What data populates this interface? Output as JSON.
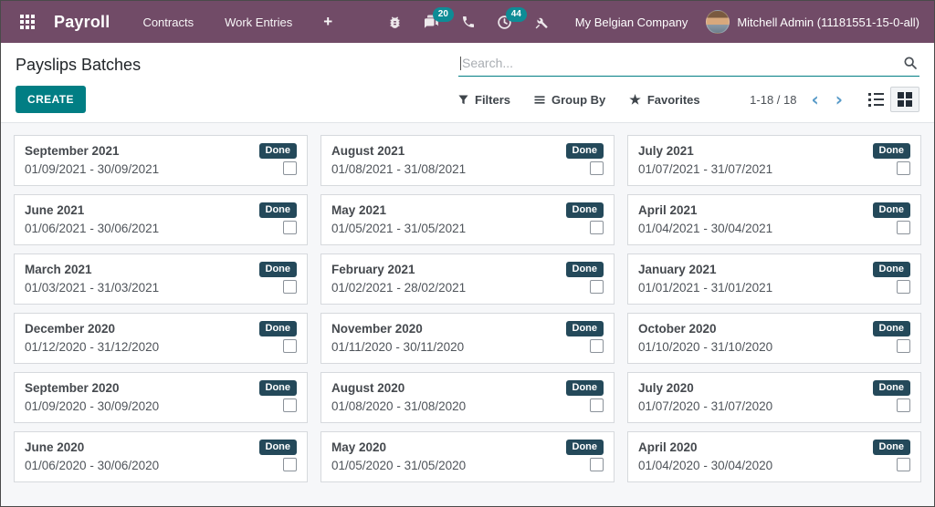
{
  "topbar": {
    "app_name": "Payroll",
    "menus": [
      {
        "label": "Contracts"
      },
      {
        "label": "Work Entries"
      },
      {
        "label": "+"
      }
    ],
    "badges": {
      "messages": "20",
      "activities": "44"
    },
    "company": "My Belgian Company",
    "user": "Mitchell Admin (11181551-15-0-all)"
  },
  "control_panel": {
    "title": "Payslips Batches",
    "create_label": "CREATE",
    "search_placeholder": "Search...",
    "filters_label": "Filters",
    "group_by_label": "Group By",
    "favorites_label": "Favorites",
    "pager_text": "1-18 / 18",
    "prev_glyph": "‹",
    "next_glyph": "›",
    "star_glyph": "★"
  },
  "colors": {
    "navbar-bg": "#714B67",
    "primary": "#017e84",
    "badge-done-bg": "#24495a",
    "icon-badge-bg": "#0e8c96",
    "pager-arrow": "#579ac8"
  },
  "cards": [
    {
      "title": "September 2021",
      "range": "01/09/2021 - 30/09/2021",
      "status": "Done"
    },
    {
      "title": "August 2021",
      "range": "01/08/2021 - 31/08/2021",
      "status": "Done"
    },
    {
      "title": "July 2021",
      "range": "01/07/2021 - 31/07/2021",
      "status": "Done"
    },
    {
      "title": "June 2021",
      "range": "01/06/2021 - 30/06/2021",
      "status": "Done"
    },
    {
      "title": "May 2021",
      "range": "01/05/2021 - 31/05/2021",
      "status": "Done"
    },
    {
      "title": "April 2021",
      "range": "01/04/2021 - 30/04/2021",
      "status": "Done"
    },
    {
      "title": "March 2021",
      "range": "01/03/2021 - 31/03/2021",
      "status": "Done"
    },
    {
      "title": "February 2021",
      "range": "01/02/2021 - 28/02/2021",
      "status": "Done"
    },
    {
      "title": "January 2021",
      "range": "01/01/2021 - 31/01/2021",
      "status": "Done"
    },
    {
      "title": "December 2020",
      "range": "01/12/2020 - 31/12/2020",
      "status": "Done"
    },
    {
      "title": "November 2020",
      "range": "01/11/2020 - 30/11/2020",
      "status": "Done"
    },
    {
      "title": "October 2020",
      "range": "01/10/2020 - 31/10/2020",
      "status": "Done"
    },
    {
      "title": "September 2020",
      "range": "01/09/2020 - 30/09/2020",
      "status": "Done"
    },
    {
      "title": "August 2020",
      "range": "01/08/2020 - 31/08/2020",
      "status": "Done"
    },
    {
      "title": "July 2020",
      "range": "01/07/2020 - 31/07/2020",
      "status": "Done"
    },
    {
      "title": "June 2020",
      "range": "01/06/2020 - 30/06/2020",
      "status": "Done"
    },
    {
      "title": "May 2020",
      "range": "01/05/2020 - 31/05/2020",
      "status": "Done"
    },
    {
      "title": "April 2020",
      "range": "01/04/2020 - 30/04/2020",
      "status": "Done"
    }
  ]
}
